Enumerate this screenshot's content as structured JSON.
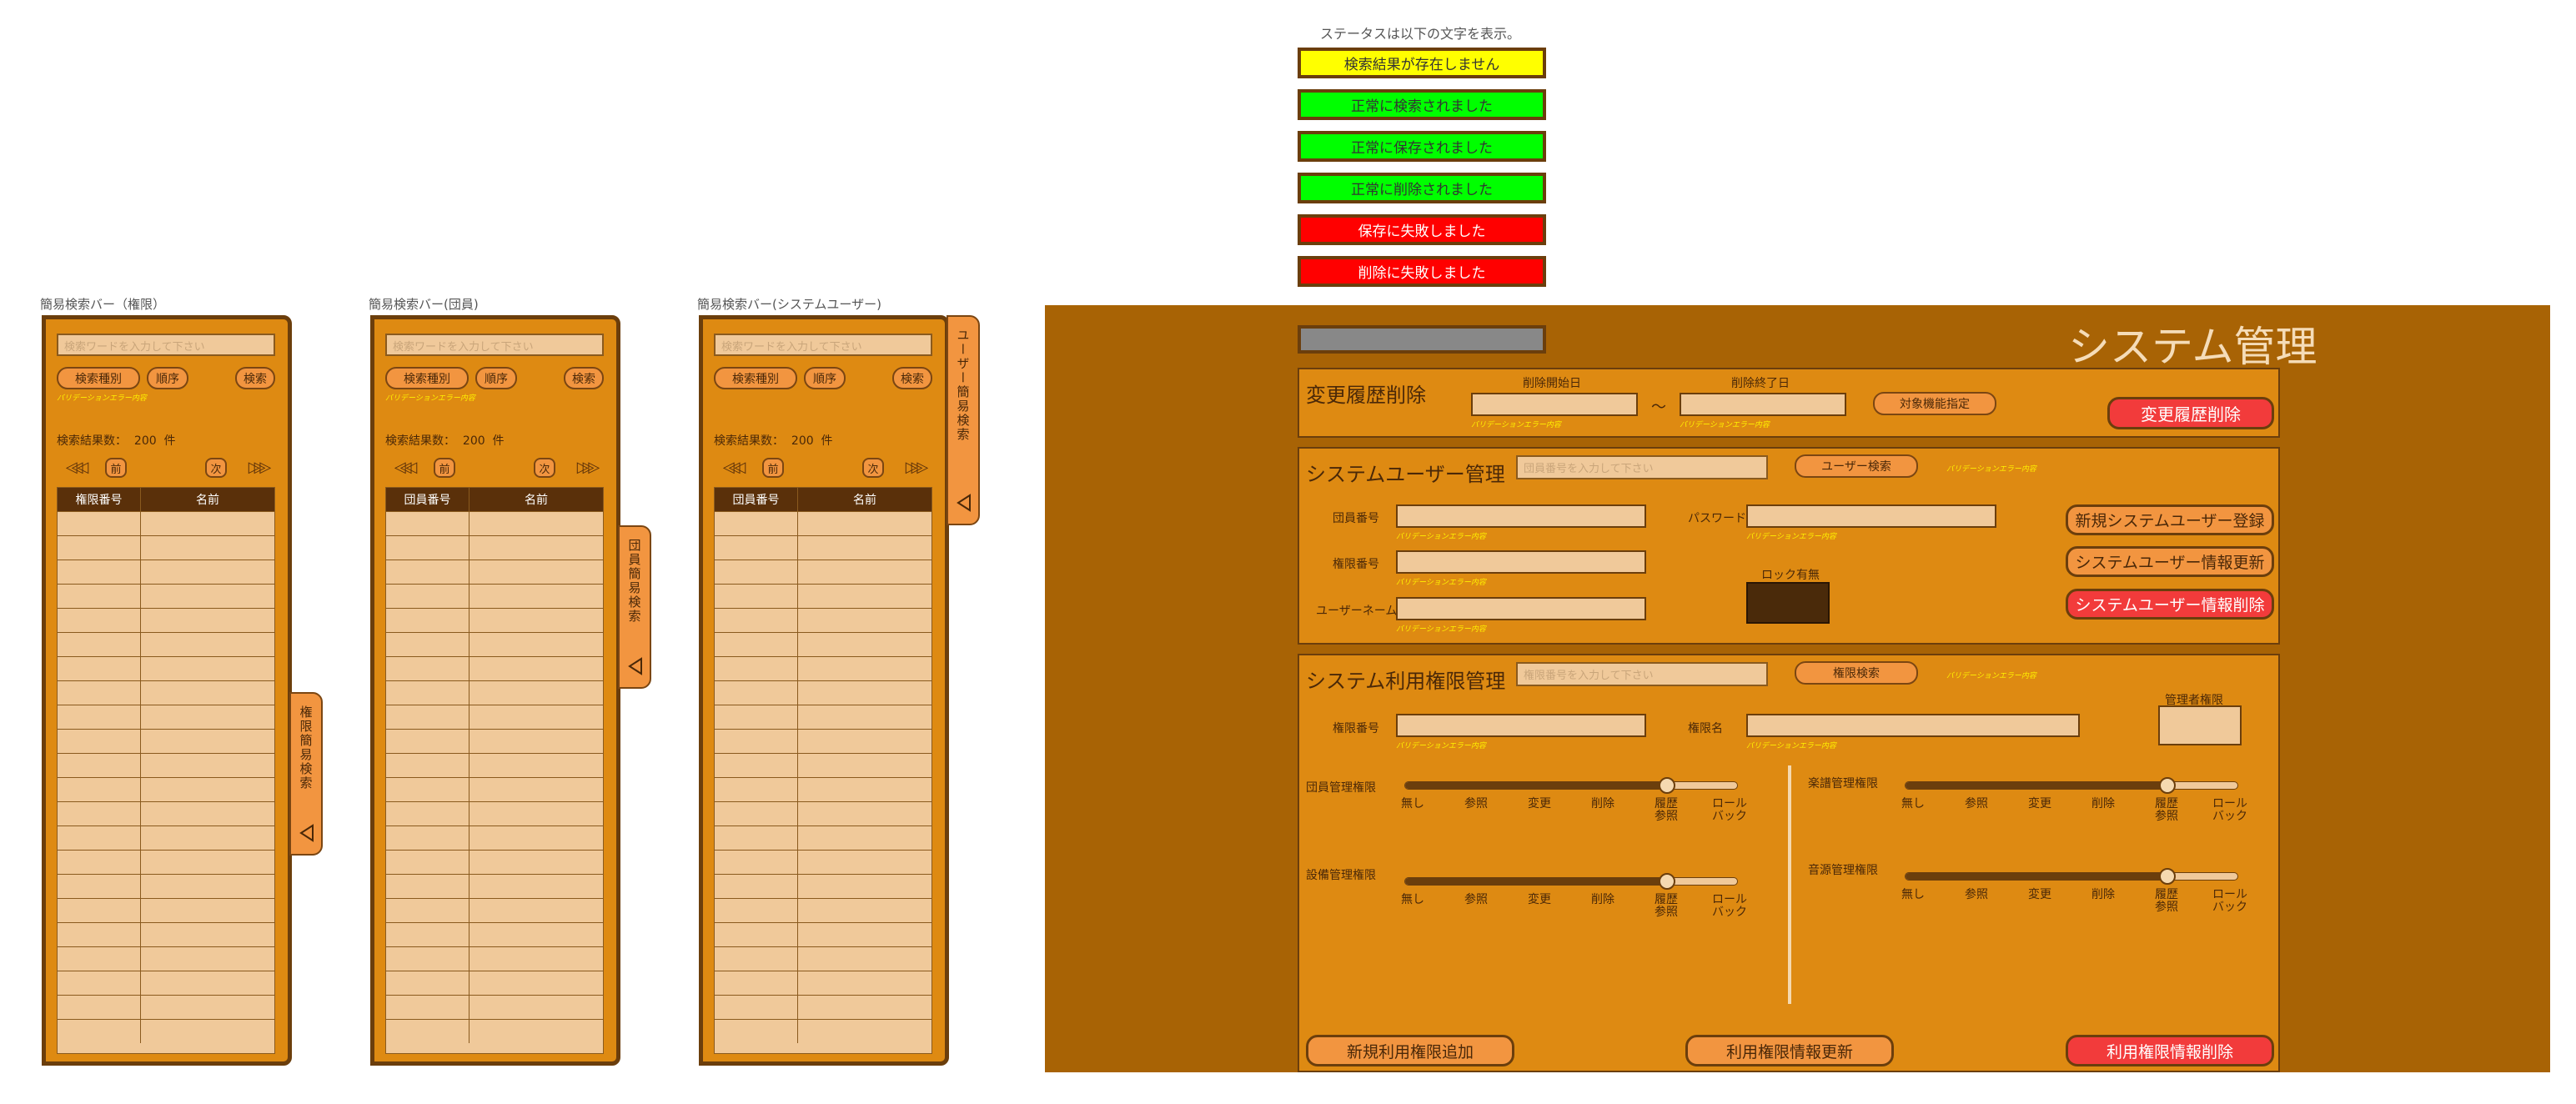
{
  "status_legend": {
    "caption": "ステータスは以下の文字を表示。",
    "items": [
      {
        "label": "検索結果が存在しません",
        "color": "#ffff00"
      },
      {
        "label": "正常に検索されました",
        "color": "#00ff00"
      },
      {
        "label": "正常に保存されました",
        "color": "#00ff00"
      },
      {
        "label": "正常に削除されました",
        "color": "#00ff00"
      },
      {
        "label": "保存に失敗しました",
        "color": "#ff0000"
      },
      {
        "label": "削除に失敗しました",
        "color": "#ff0000"
      }
    ]
  },
  "search_panels": [
    {
      "caption": "簡易検索バー（権限）",
      "placeholder": "検索ワードを入力して下さい",
      "type_btn": "検索種別",
      "order_btn": "順序",
      "search_btn": "検索",
      "validation": "バリデーションエラー内容",
      "count_label": "検索結果数：",
      "count": "200",
      "count_unit": "件",
      "first": "◁◁◁",
      "prev": "前",
      "next": "次",
      "last": "▷▷▷",
      "col1": "権限番号",
      "col2": "名前",
      "tab_label": "権限簡易検索"
    },
    {
      "caption": "簡易検索バー(団員)",
      "placeholder": "検索ワードを入力して下さい",
      "type_btn": "検索種別",
      "order_btn": "順序",
      "search_btn": "検索",
      "validation": "バリデーションエラー内容",
      "count_label": "検索結果数：",
      "count": "200",
      "count_unit": "件",
      "first": "◁◁◁",
      "prev": "前",
      "next": "次",
      "last": "▷▷▷",
      "col1": "団員番号",
      "col2": "名前",
      "tab_label": "団員簡易検索"
    },
    {
      "caption": "簡易検索バー(システムユーザー)",
      "placeholder": "検索ワードを入力して下さい",
      "type_btn": "検索種別",
      "order_btn": "順序",
      "search_btn": "検索",
      "validation": "",
      "count_label": "検索結果数：",
      "count": "200",
      "count_unit": "件",
      "first": "◁◁◁",
      "prev": "前",
      "next": "次",
      "last": "▷▷▷",
      "col1": "団員番号",
      "col2": "名前",
      "tab_label": "ユーザー簡易検索"
    }
  ],
  "main": {
    "title": "システム管理",
    "history": {
      "heading": "変更履歴削除",
      "start_label": "削除開始日",
      "end_label": "削除終了日",
      "tilde": "～",
      "validation": "バリデーションエラー内容",
      "target_btn": "対象機能指定",
      "delete_btn": "変更履歴削除"
    },
    "user": {
      "heading": "システムユーザー管理",
      "search_placeholder": "団員番号を入力して下さい",
      "search_btn": "ユーザー検索",
      "validation": "バリデーションエラー内容",
      "member_no": "団員番号",
      "auth_no": "権限番号",
      "username": "ユーザーネーム",
      "password": "パスワード",
      "lock": "ロック有無",
      "new_btn": "新規システムユーザー登録",
      "update_btn": "システムユーザー情報更新",
      "delete_btn": "システムユーザー情報削除"
    },
    "perm": {
      "heading": "システム利用権限管理",
      "search_placeholder": "権限番号を入力して下さい",
      "search_btn": "権限検索",
      "validation": "バリデーションエラー内容",
      "auth_no": "権限番号",
      "auth_name": "権限名",
      "admin": "管理者権限",
      "sliders": [
        {
          "label": "団員管理権限",
          "level": 4
        },
        {
          "label": "楽譜管理権限",
          "level": 4
        },
        {
          "label": "設備管理権限",
          "level": 4
        },
        {
          "label": "音源管理権限",
          "level": 4
        }
      ],
      "ticks": [
        "無し",
        "参照",
        "変更",
        "削除",
        "履歴\n参照",
        "ロール\nバック"
      ],
      "add_btn": "新規利用権限追加",
      "update_btn": "利用権限情報更新",
      "delete_btn": "利用権限情報削除"
    }
  }
}
